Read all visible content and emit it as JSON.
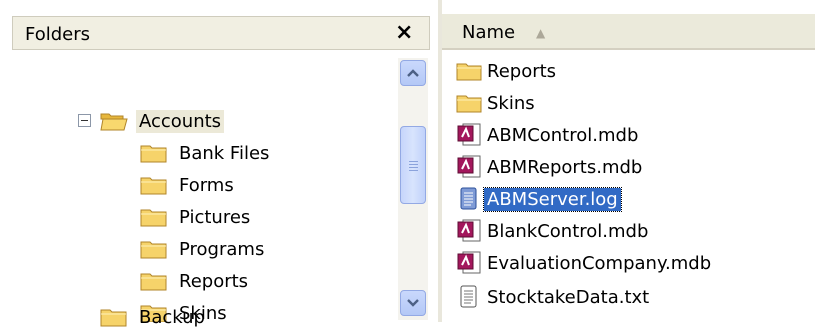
{
  "folders_panel": {
    "title": "Folders",
    "close_glyph": "×",
    "tree": [
      {
        "label": "Accounts",
        "expanded": true,
        "selected": true
      },
      {
        "label": "Bank Files"
      },
      {
        "label": "Forms"
      },
      {
        "label": "Pictures"
      },
      {
        "label": "Programs"
      },
      {
        "label": "Reports"
      },
      {
        "label": "Skins"
      },
      {
        "label": "Backup"
      }
    ]
  },
  "file_list": {
    "column_header": "Name",
    "sort_glyph": "▲",
    "items": [
      {
        "name": "Reports",
        "icon": "folder-icon"
      },
      {
        "name": "Skins",
        "icon": "folder-icon"
      },
      {
        "name": "ABMControl.mdb",
        "icon": "access-db-icon"
      },
      {
        "name": "ABMReports.mdb",
        "icon": "access-db-icon"
      },
      {
        "name": "ABMServer.log",
        "icon": "log-file-icon",
        "selected": true
      },
      {
        "name": "BlankControl.mdb",
        "icon": "access-db-icon"
      },
      {
        "name": "EvaluationCompany.mdb",
        "icon": "access-db-icon"
      },
      {
        "name": "StocktakeData.txt",
        "icon": "text-file-icon"
      }
    ]
  },
  "colors": {
    "selection": "#316ac5",
    "header_bg": "#ebeadb",
    "folder_yellow": "#f6d36a",
    "scrollbar_blue": "#b4c8f6"
  }
}
